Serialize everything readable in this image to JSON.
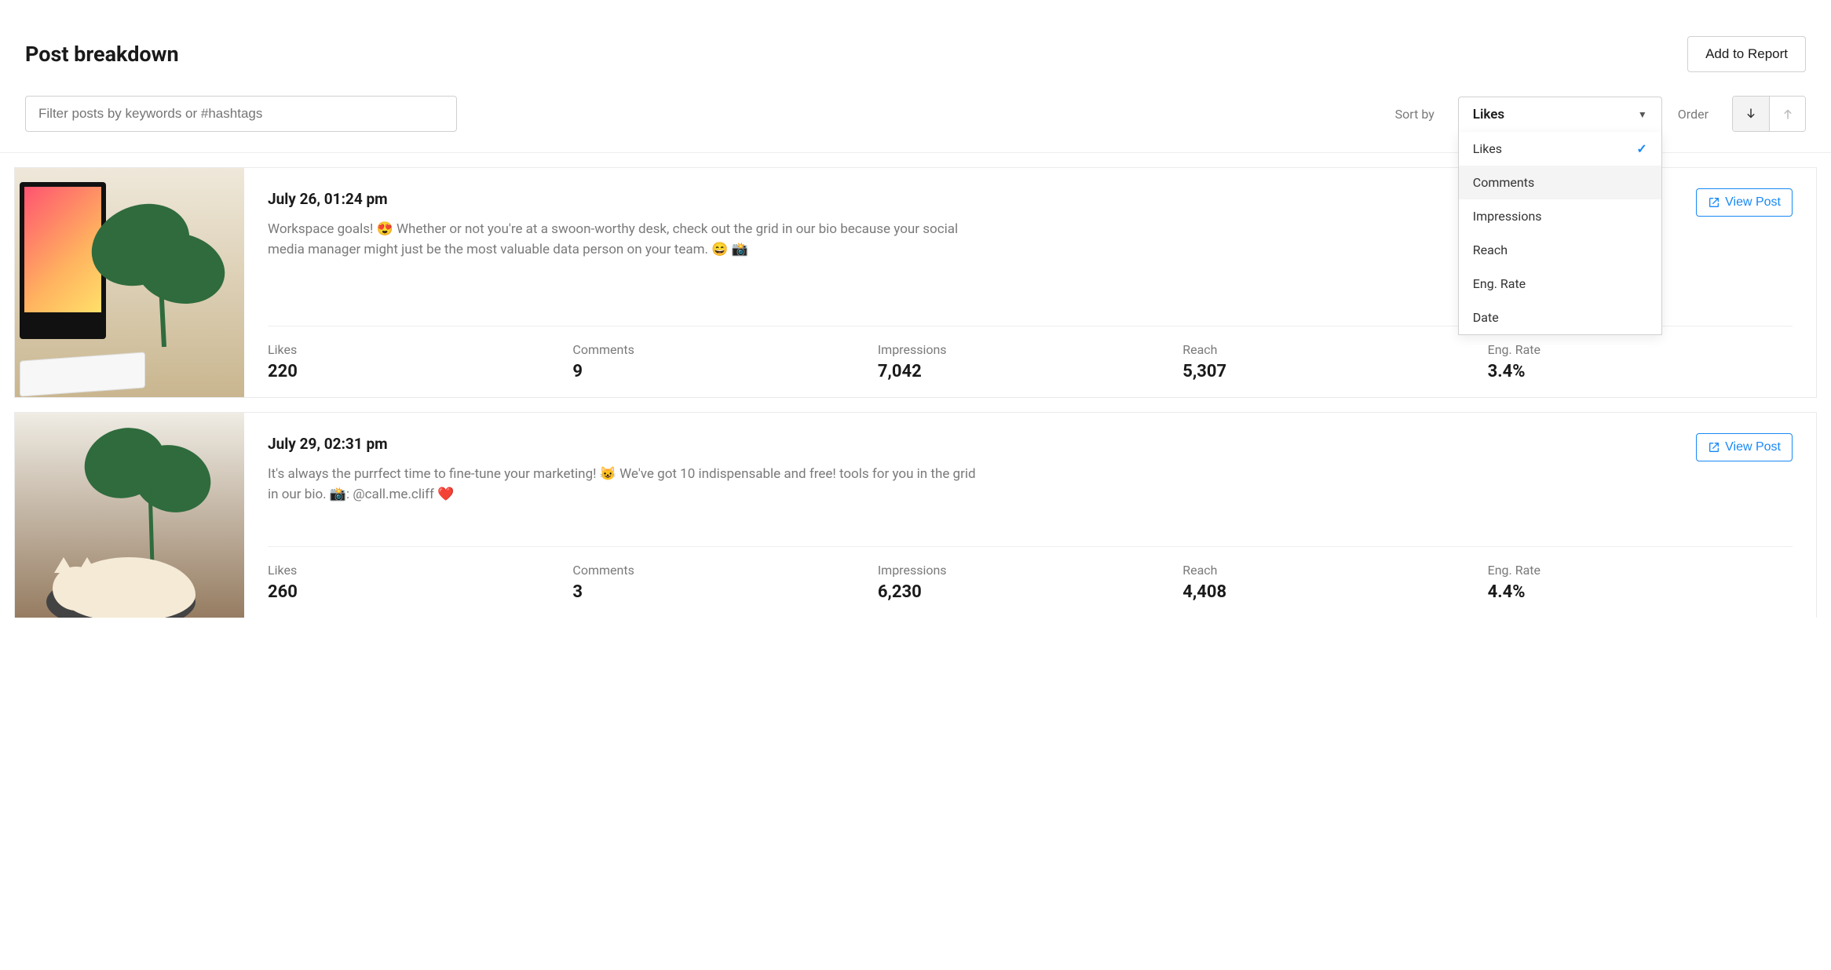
{
  "header": {
    "title": "Post breakdown",
    "add_to_report": "Add to Report"
  },
  "filter": {
    "placeholder": "Filter posts by keywords or #hashtags",
    "value": ""
  },
  "sort": {
    "label": "Sort by",
    "selected": "Likes",
    "options": [
      {
        "label": "Likes",
        "selected": true,
        "highlighted": false
      },
      {
        "label": "Comments",
        "selected": false,
        "highlighted": true
      },
      {
        "label": "Impressions",
        "selected": false,
        "highlighted": false
      },
      {
        "label": "Reach",
        "selected": false,
        "highlighted": false
      },
      {
        "label": "Eng. Rate",
        "selected": false,
        "highlighted": false
      },
      {
        "label": "Date",
        "selected": false,
        "highlighted": false
      }
    ]
  },
  "order": {
    "label": "Order",
    "active": "desc"
  },
  "view_post_label": "View Post",
  "metric_labels": {
    "likes": "Likes",
    "comments": "Comments",
    "impressions": "Impressions",
    "reach": "Reach",
    "eng_rate": "Eng. Rate"
  },
  "posts": [
    {
      "date": "July 26, 01:24 pm",
      "text": "Workspace goals! 😍 Whether or not you're at a swoon-worthy desk, check out the grid in our bio because your social media manager might just be the most valuable data person on your team. 😄 📸",
      "metrics": {
        "likes": "220",
        "comments": "9",
        "impressions": "7,042",
        "reach": "5,307",
        "eng_rate": "3.4%"
      }
    },
    {
      "date": "July 29, 02:31 pm",
      "text": "It's always the purrfect time to fine-tune your marketing! 😺 We've got 10 indispensable and free! tools for you in the grid in our bio. 📸: @call.me.cliff ❤️",
      "metrics": {
        "likes": "260",
        "comments": "3",
        "impressions": "6,230",
        "reach": "4,408",
        "eng_rate": "4.4%"
      }
    }
  ]
}
